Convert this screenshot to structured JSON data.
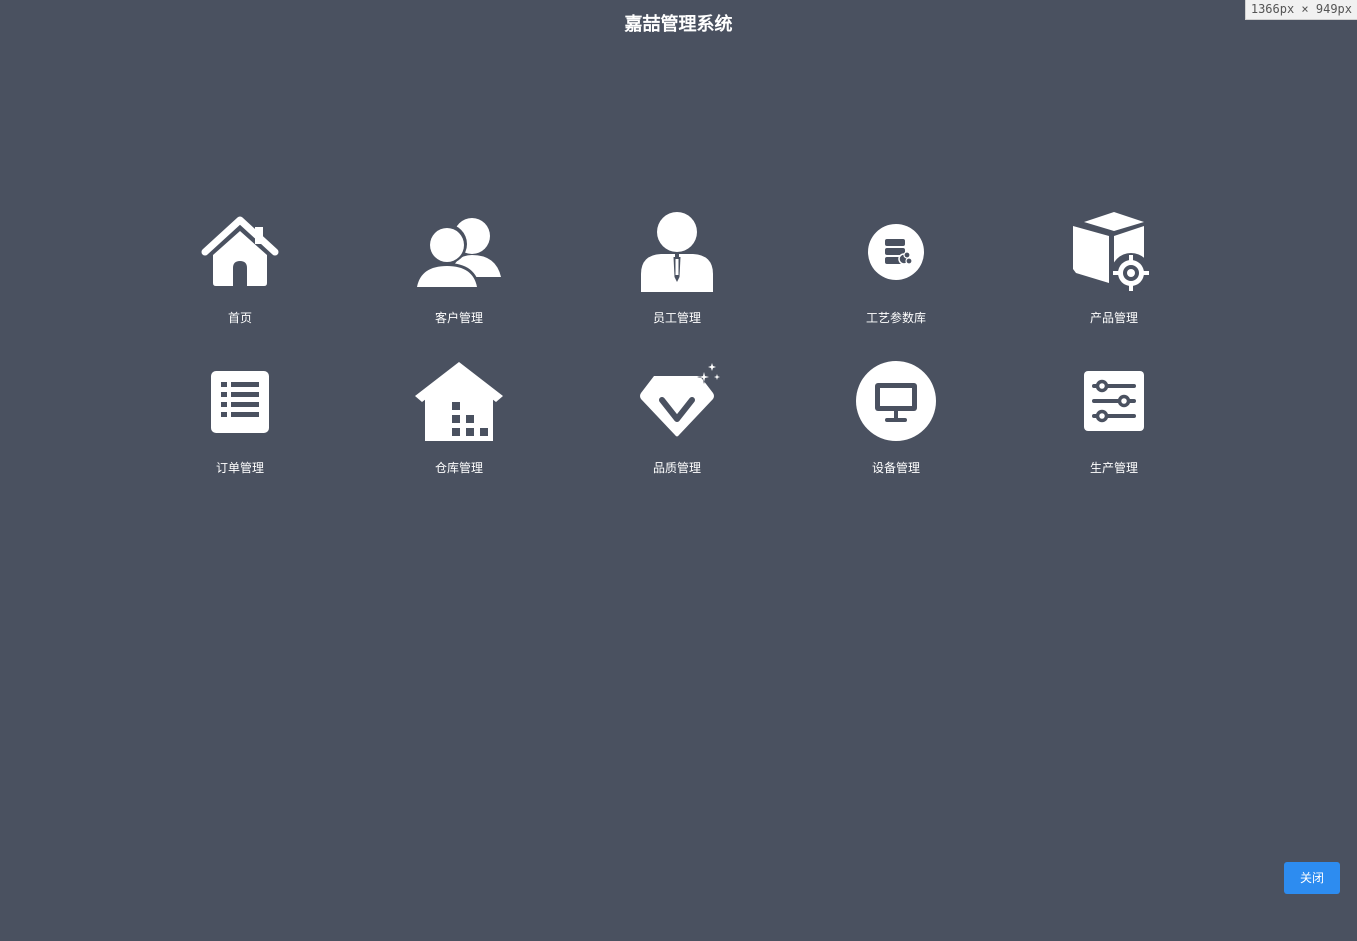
{
  "header": {
    "title": "嘉喆管理系统",
    "viewport_badge": "1366px × 949px"
  },
  "modules": [
    {
      "label": "首页",
      "icon": "home-icon"
    },
    {
      "label": "客户管理",
      "icon": "users-icon"
    },
    {
      "label": "员工管理",
      "icon": "employee-icon"
    },
    {
      "label": "工艺参数库",
      "icon": "database-icon"
    },
    {
      "label": "产品管理",
      "icon": "product-box-icon"
    },
    {
      "label": "订单管理",
      "icon": "list-icon"
    },
    {
      "label": "仓库管理",
      "icon": "warehouse-icon"
    },
    {
      "label": "品质管理",
      "icon": "diamond-icon"
    },
    {
      "label": "设备管理",
      "icon": "monitor-icon"
    },
    {
      "label": "生产管理",
      "icon": "sliders-icon"
    }
  ],
  "footer": {
    "close_label": "关闭"
  },
  "colors": {
    "background": "#4a5160",
    "icon": "#ffffff",
    "accent": "#2d8cf0"
  }
}
